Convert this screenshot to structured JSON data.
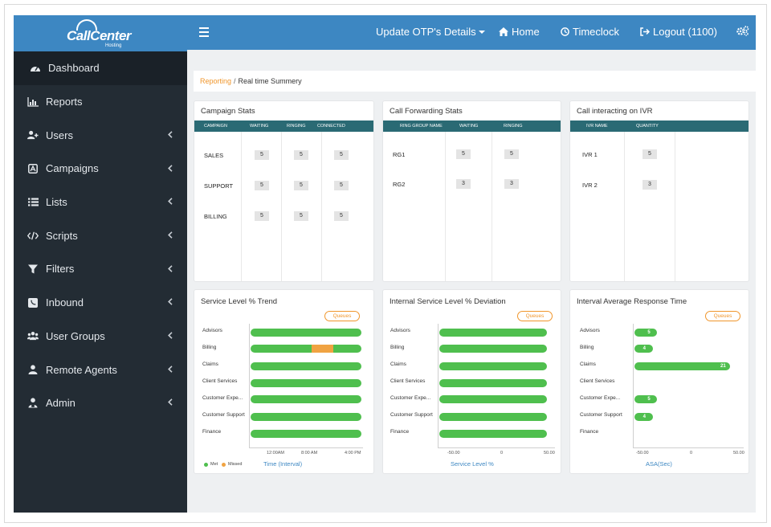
{
  "logo": {
    "name": "CallCenter",
    "sub": "Hosting"
  },
  "sidebar": {
    "items": [
      {
        "label": "Dashboard",
        "icon": "dashboard-icon"
      },
      {
        "label": "Reports",
        "icon": "bar-chart-icon"
      },
      {
        "label": "Users",
        "icon": "user-plus-icon"
      },
      {
        "label": "Campaigns",
        "icon": "campaign-icon"
      },
      {
        "label": "Lists",
        "icon": "list-icon"
      },
      {
        "label": "Scripts",
        "icon": "code-icon"
      },
      {
        "label": "Filters",
        "icon": "filter-icon"
      },
      {
        "label": "Inbound",
        "icon": "phone-icon"
      },
      {
        "label": "User Groups",
        "icon": "users-icon"
      },
      {
        "label": "Remote Agents",
        "icon": "user-icon"
      },
      {
        "label": "Admin",
        "icon": "admin-icon"
      }
    ]
  },
  "topbar": {
    "otp": "Update OTP's Details",
    "home": "Home",
    "timeclock": "Timeclock",
    "logout": "Logout (1100)"
  },
  "breadcrumb": {
    "link": "Reporting",
    "sep": "/",
    "current": "Real time Summery"
  },
  "campaign_stats": {
    "title": "Campaign Stats",
    "headers": [
      "CAMPAIGN",
      "WAITING",
      "RINGING",
      "CONNECTED"
    ],
    "rows": [
      {
        "name": "SALES",
        "waiting": "5",
        "ringing": "5",
        "connected": "5"
      },
      {
        "name": "SUPPORT",
        "waiting": "5",
        "ringing": "5",
        "connected": "5"
      },
      {
        "name": "BILLING",
        "waiting": "5",
        "ringing": "5",
        "connected": "5"
      }
    ]
  },
  "call_forwarding": {
    "title": "Call Forwarding Stats",
    "headers": [
      "RING GROUP NAME",
      "WAITING",
      "RINGING"
    ],
    "rows": [
      {
        "name": "RG1",
        "waiting": "5",
        "ringing": "5"
      },
      {
        "name": "RG2",
        "waiting": "3",
        "ringing": "3"
      }
    ]
  },
  "ivr": {
    "title": "Call interacting on IVR",
    "headers": [
      "IVR NAME",
      "QUANTITY"
    ],
    "rows": [
      {
        "name": "IVR 1",
        "quantity": "5"
      },
      {
        "name": "IVR 2",
        "quantity": "3"
      }
    ]
  },
  "queues_label": "Queues",
  "colors": {
    "met": "#4fbf4e",
    "missed": "#f0a342",
    "accent": "#3d87c2",
    "orange": "#f0962c"
  },
  "chart_data": [
    {
      "type": "bar",
      "title": "Service Level % Trend",
      "categories": [
        "Advisors",
        "Billing",
        "Claims",
        "Client Services",
        "Customer Expe...",
        "Customer Support",
        "Finance"
      ],
      "x_ticks": [
        "12:00AM",
        "8:00 AM",
        "4:00 PM"
      ],
      "xlabel": "Time (Interval)",
      "legend": [
        "Met",
        "Missed"
      ],
      "series": [
        {
          "name": "Met",
          "values": [
            1,
            1,
            1,
            1,
            1,
            1,
            1
          ]
        },
        {
          "name": "Missed",
          "values": [
            0,
            0.2,
            0,
            0,
            0,
            0,
            0
          ]
        }
      ]
    },
    {
      "type": "bar",
      "title": "Internal Service Level % Deviation",
      "categories": [
        "Advisors",
        "Billing",
        "Claims",
        "Client Services",
        "Customer Expe...",
        "Customer Support",
        "Finance"
      ],
      "x_ticks": [
        "-50.00",
        "0",
        "50.00"
      ],
      "xlim": [
        -50,
        50
      ],
      "xlabel": "Service Level %",
      "values": [
        50,
        50,
        50,
        50,
        50,
        50,
        50
      ]
    },
    {
      "type": "bar",
      "title": "Interval Average Response Time",
      "categories": [
        "Advisors",
        "Billing",
        "Claims",
        "Client Services",
        "Customer Expe...",
        "Customer Support",
        "Finance"
      ],
      "x_ticks": [
        "-50.00",
        "0",
        "50.00"
      ],
      "xlim": [
        -50,
        50
      ],
      "xlabel": "ASA(Sec)",
      "values": [
        5,
        4,
        21,
        null,
        5,
        4,
        null
      ],
      "data_labels": [
        "5",
        "4",
        "21",
        "",
        "5",
        "4",
        ""
      ]
    }
  ]
}
